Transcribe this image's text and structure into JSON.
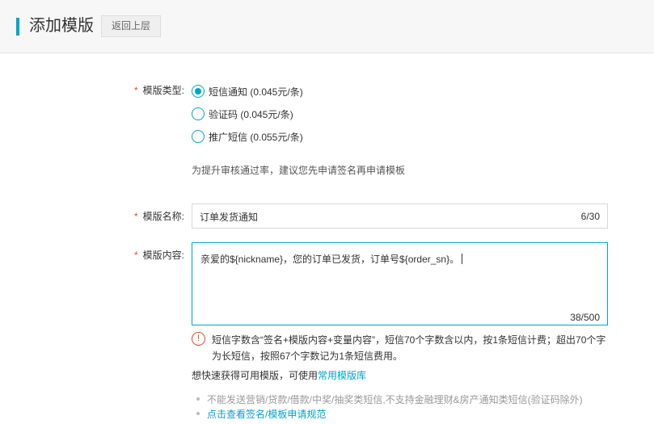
{
  "header": {
    "title": "添加模版",
    "back_label": "返回上层"
  },
  "form": {
    "type_label": "模版类型:",
    "type_options": [
      {
        "label": "短信通知 (0.045元/条)",
        "checked": true
      },
      {
        "label": "验证码 (0.045元/条)",
        "checked": false
      },
      {
        "label": "推广短信 (0.055元/条)",
        "checked": false
      }
    ],
    "type_hint": "为提升审核通过率，建议您先申请签名再申请模板",
    "name_label": "模版名称:",
    "name_value": "订单发货通知",
    "name_count": "6/30",
    "content_label": "模版内容:",
    "content_value": "亲爱的${nickname}，您的订单已发货，订单号${order_sn}。",
    "content_count": "38/500",
    "warning_icon": "!",
    "warning_text": "短信字数含“签名+模版内容+变量内容”，短信70个字数含以内，按1条短信计费；超出70个字为长短信，按照67个字数记为1条短信费用。",
    "library_prefix": "想快速获得可用模版，可使用",
    "library_link": "常用模版库",
    "notes": [
      "不能发送营销/贷款/借款/中奖/抽奖类短信,不支持金融理财&房产通知类短信(验证码除外)",
      "点击查看签名/模板申请规范"
    ]
  },
  "colors": {
    "accent": "#00a4c8",
    "required": "#e0502e"
  }
}
